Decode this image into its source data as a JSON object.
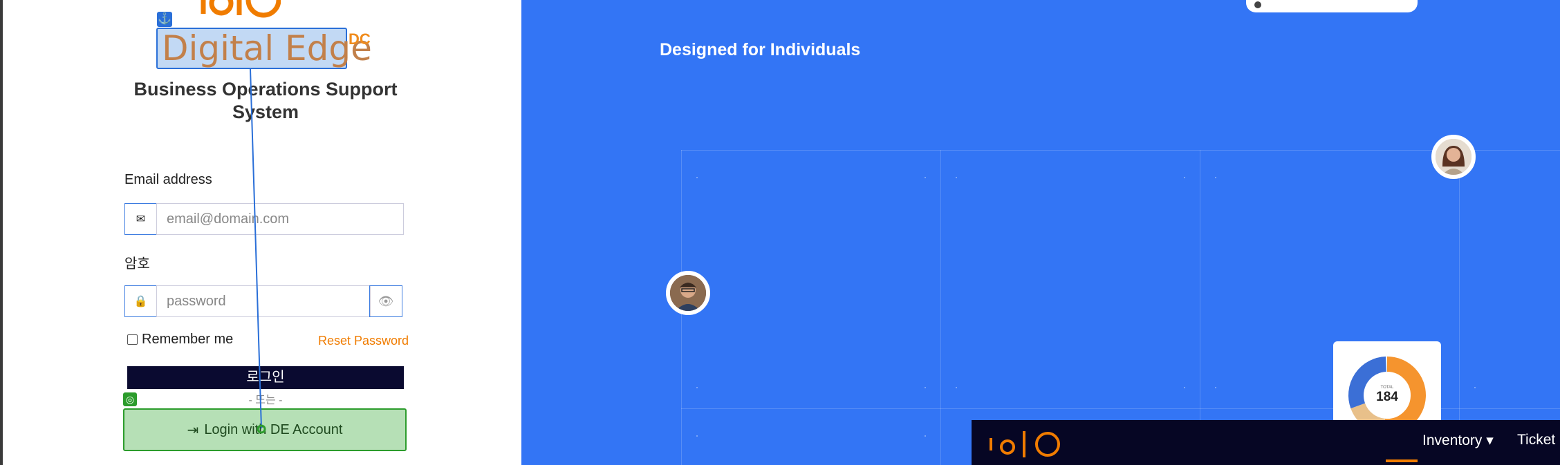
{
  "brand": {
    "name": "Digital Edge",
    "suffix": "DC",
    "tagline": "Business Operations Support System"
  },
  "form": {
    "email_label": "Email address",
    "email_placeholder": "email@domain.com",
    "password_label": "암호",
    "password_placeholder": "password",
    "remember_label": "Remember me",
    "reset_link": "Reset Password",
    "login_button": "로그인",
    "or_text": "- 또는 -",
    "de_button": "Login with DE Account"
  },
  "hero": {
    "title": "Designed for Individuals",
    "donut": {
      "total_label": "TOTAL",
      "total_value": "184"
    },
    "nav_items": [
      "Inventory",
      "Ticket"
    ]
  },
  "chart_data": {
    "type": "pie",
    "title": "",
    "total": 184,
    "colors": [
      "#f5942e",
      "#e8c08a",
      "#3b6fd6"
    ]
  },
  "colors": {
    "accent": "#f07c00",
    "hero_bg": "#3375f5",
    "login_btn": "#0a0a30"
  },
  "icons": [
    "anchor-icon",
    "envelope-icon",
    "lock-icon",
    "eye-icon",
    "target-icon",
    "sign-in-icon"
  ]
}
